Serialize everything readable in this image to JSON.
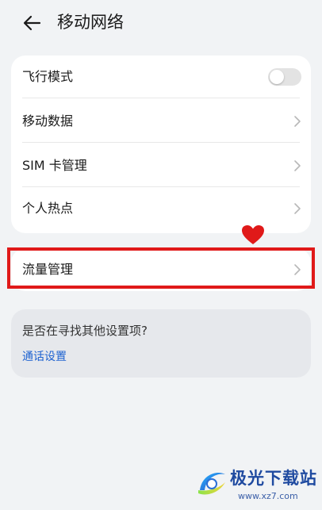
{
  "header": {
    "title": "移动网络",
    "back_icon": "arrow-left-icon"
  },
  "main_card": {
    "items": [
      {
        "label": "飞行模式",
        "control": "toggle",
        "toggle_on": false
      },
      {
        "label": "移动数据",
        "control": "chevron"
      },
      {
        "label": "SIM 卡管理",
        "control": "chevron"
      },
      {
        "label": "个人热点",
        "control": "chevron"
      }
    ]
  },
  "traffic_card": {
    "label": "流量管理",
    "control": "chevron"
  },
  "annotation": {
    "highlight_color": "#e01919",
    "heart_color": "#e01919",
    "heart_icon": "heart-icon"
  },
  "search_card": {
    "question": "是否在寻找其他设置项?",
    "link": "通话设置",
    "link_color": "#1e62d0"
  },
  "watermark": {
    "name": "极光下载站",
    "url": "www.xz7.com",
    "logo_icon": "aurora-logo-icon"
  },
  "colors": {
    "background": "#f1f3f5",
    "card": "#ffffff",
    "toggle_off": "#e3e3e3"
  }
}
